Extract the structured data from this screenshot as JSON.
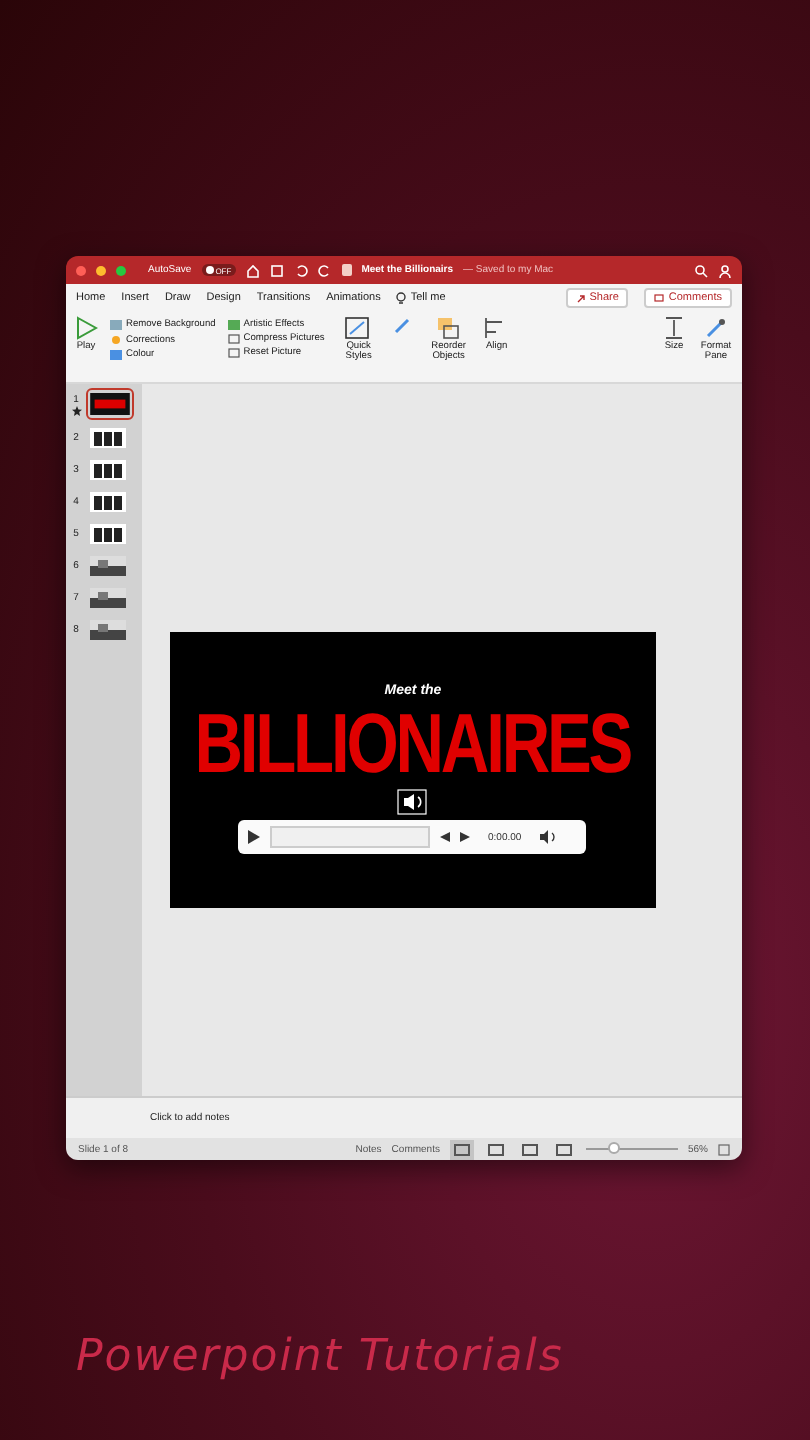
{
  "window": {
    "autosave_label": "AutoSave",
    "autosave": {
      "on": false,
      "label": "OFF"
    },
    "title": "Meet the Billionairs",
    "subtitle": "— Saved to my Mac"
  },
  "tabs": [
    {
      "label": "Home",
      "selected": false
    },
    {
      "label": "Insert",
      "selected": false
    },
    {
      "label": "Draw",
      "selected": false
    },
    {
      "label": "Design",
      "selected": false
    },
    {
      "label": "Transitions",
      "selected": false
    },
    {
      "label": "Animations",
      "selected": false
    }
  ],
  "tell_me": "Tell me",
  "share": "Share",
  "comments": "Comments",
  "ribbon": {
    "play": "Play",
    "adjust": [
      "Remove Background",
      "Corrections",
      "Colour"
    ],
    "effects": [
      "Artistic Effects",
      "Compress Pictures",
      "Reset Picture"
    ],
    "quick_styles": "Quick Styles",
    "arrange": [
      "Reorder Objects",
      "Align"
    ],
    "size": "Size",
    "format_pane": "Format Pane"
  },
  "slides": [
    {
      "number": "1",
      "selected": true,
      "animated": true,
      "kind": "title"
    },
    {
      "number": "2",
      "selected": false,
      "animated": false,
      "kind": "cards"
    },
    {
      "number": "3",
      "selected": false,
      "animated": false,
      "kind": "cards"
    },
    {
      "number": "4",
      "selected": false,
      "animated": false,
      "kind": "cards"
    },
    {
      "number": "5",
      "selected": false,
      "animated": false,
      "kind": "cards"
    },
    {
      "number": "6",
      "selected": false,
      "animated": false,
      "kind": "photo"
    },
    {
      "number": "7",
      "selected": false,
      "animated": false,
      "kind": "photo"
    },
    {
      "number": "8",
      "selected": false,
      "animated": false,
      "kind": "photo"
    }
  ],
  "slide": {
    "title": "BILLIONAIRES",
    "subtitle": "Meet the",
    "player_time": "0:00.00"
  },
  "notes_placeholder": "Click to add notes",
  "status_bar": {
    "slide_info": "Slide 1 of 8",
    "notes": "Notes",
    "comments": "Comments",
    "views": [
      {
        "selected": true
      },
      {
        "selected": false
      },
      {
        "selected": false
      },
      {
        "selected": false
      }
    ],
    "zoom": {
      "level": 0.3
    },
    "zoom_reading": "56%"
  },
  "caption": "Powerpoint Tutorials"
}
